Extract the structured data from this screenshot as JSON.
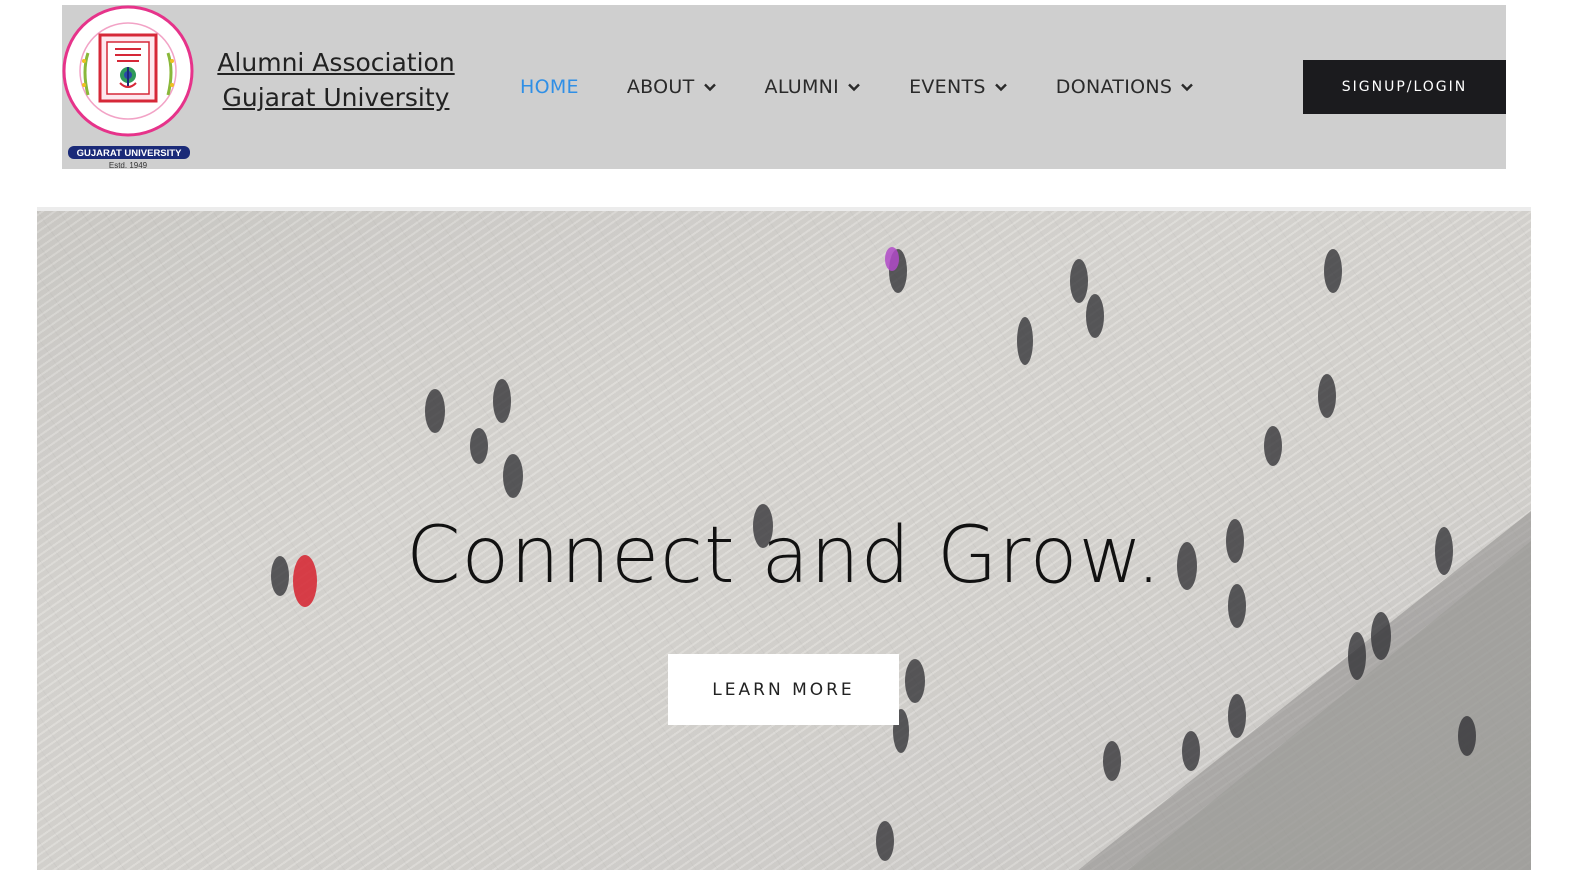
{
  "brand": {
    "line1": "Alumni Association",
    "line2": "Gujarat University",
    "logo_caption": "GUJARAT UNIVERSITY",
    "logo_estd": "Estd. 1949"
  },
  "nav": {
    "items": [
      {
        "label": "HOME",
        "active": true,
        "dropdown": false
      },
      {
        "label": "ABOUT",
        "active": false,
        "dropdown": true
      },
      {
        "label": "ALUMNI",
        "active": false,
        "dropdown": true
      },
      {
        "label": "EVENTS",
        "active": false,
        "dropdown": true
      },
      {
        "label": "DONATIONS",
        "active": false,
        "dropdown": true
      }
    ],
    "signup_label": "SIGNUP/LOGIN"
  },
  "hero": {
    "title": "Connect and Grow.",
    "cta_label": "LEARN MORE"
  },
  "colors": {
    "header_bg": "#cfcfcf",
    "nav_active": "#2f8fe6",
    "signup_bg": "#1b1b1e",
    "logo_ring": "#e6338a",
    "logo_badge": "#1a2a78"
  },
  "icons": {
    "dropdown": "chevron-down-icon",
    "logo": "university-seal-icon"
  }
}
